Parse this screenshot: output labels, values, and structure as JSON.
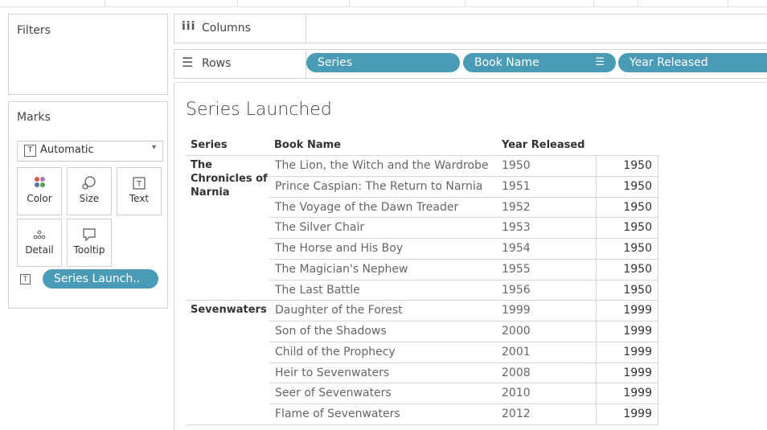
{
  "filters": {
    "title": "Filters"
  },
  "marks": {
    "title": "Marks",
    "type_select": "Automatic",
    "buttons": [
      "Color",
      "Size",
      "Text",
      "Detail",
      "Tooltip"
    ],
    "field_pill": "Series Launch.."
  },
  "shelves": {
    "columns_label": "Columns",
    "rows_label": "Rows",
    "rows_pills": [
      "Series",
      "Book Name",
      "Year Released"
    ]
  },
  "view": {
    "title": "Series Launched",
    "headers": [
      "Series",
      "Book Name",
      "Year Released"
    ],
    "groups": [
      {
        "series": "The Chronicles of Narnia",
        "series_lines": [
          "The",
          "Chronicles of",
          "Narnia"
        ],
        "rows": [
          {
            "book": "The Lion, the Witch and the Wardrobe",
            "year": "1950",
            "launched": "1950"
          },
          {
            "book": "Prince Caspian: The Return to Narnia",
            "year": "1951",
            "launched": "1950"
          },
          {
            "book": "The Voyage of the Dawn Treader",
            "year": "1952",
            "launched": "1950"
          },
          {
            "book": "The Silver Chair",
            "year": "1953",
            "launched": "1950"
          },
          {
            "book": "The Horse and His Boy",
            "year": "1954",
            "launched": "1950"
          },
          {
            "book": "The Magician's Nephew",
            "year": "1955",
            "launched": "1950"
          },
          {
            "book": "The Last Battle",
            "year": "1956",
            "launched": "1950"
          }
        ]
      },
      {
        "series": "Sevenwaters",
        "series_lines": [
          "Sevenwaters"
        ],
        "rows": [
          {
            "book": "Daughter of the Forest",
            "year": "1999",
            "launched": "1999"
          },
          {
            "book": "Son of the Shadows",
            "year": "2000",
            "launched": "1999"
          },
          {
            "book": "Child of the Prophecy",
            "year": "2001",
            "launched": "1999"
          },
          {
            "book": "Heir to Sevenwaters",
            "year": "2008",
            "launched": "1999"
          },
          {
            "book": "Seer of Sevenwaters",
            "year": "2010",
            "launched": "1999"
          },
          {
            "book": "Flame of Sevenwaters",
            "year": "2012",
            "launched": "1999"
          }
        ]
      }
    ]
  },
  "colors": {
    "pill": "#4a9bb5"
  }
}
